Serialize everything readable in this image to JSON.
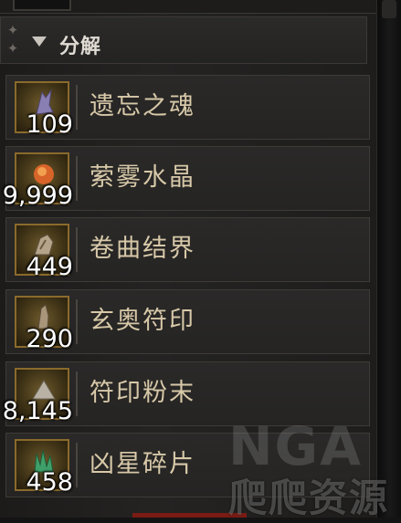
{
  "section": {
    "title": "分解",
    "collapse_icon": "caret-down-icon"
  },
  "items": [
    {
      "name": "遗忘之魂",
      "count": "109",
      "icon": "forgotten-soul-icon",
      "art_color": "#8a7fb2"
    },
    {
      "name": "萦雾水晶",
      "count": "9,999",
      "icon": "veiled-crystal-icon",
      "art_color": "#d8642a"
    },
    {
      "name": "卷曲结界",
      "count": "449",
      "icon": "coiling-ward-icon",
      "art_color": "#b5a48a"
    },
    {
      "name": "玄奥符印",
      "count": "290",
      "icon": "abstruse-sigil-icon",
      "art_color": "#a8957a"
    },
    {
      "name": "符印粉末",
      "count": "8,145",
      "icon": "sigil-powder-icon",
      "art_color": "#b9b2a4"
    },
    {
      "name": "凶星碎片",
      "count": "458",
      "icon": "baneful-shard-icon",
      "art_color": "#3fa06a"
    }
  ],
  "watermark": {
    "logo": "NGA",
    "text": "爬爬资源"
  }
}
